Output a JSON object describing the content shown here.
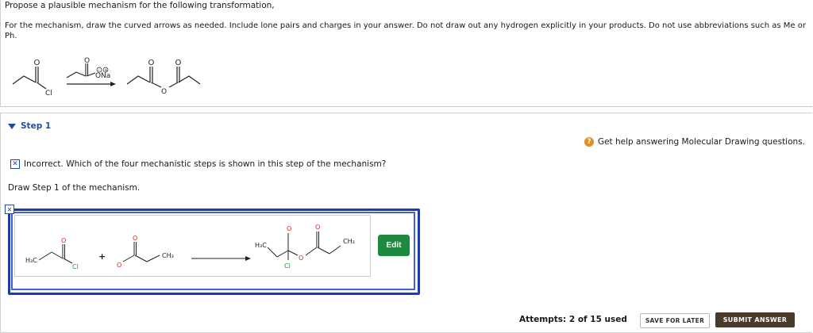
{
  "question": {
    "title": "Propose a plausible mechanism for the following transformation,",
    "instructions": "For the mechanism, draw the curved arrows as needed. Include lone pairs and charges in your answer.  Do not draw out any hydrogen explicitly in your products. Do not use abbreviations such as Me or Ph.",
    "reaction": {
      "reactant_atoms": [
        "O",
        "Cl"
      ],
      "reagent_atoms": [
        "O",
        "O",
        "Na"
      ],
      "reagent_charges": [
        "-",
        "+"
      ],
      "product_atoms": [
        "O",
        "O",
        "O"
      ]
    }
  },
  "step": {
    "label": "Step 1",
    "help_text": "Get help answering Molecular Drawing questions.",
    "help_icon": "question-mark-icon",
    "feedback_icon": "x-mark-icon",
    "feedback_text": "Incorrect. Which of the four mechanistic steps is shown in this step of the mechanism?",
    "draw_label": "Draw Step 1 of the mechanism.",
    "drawing": {
      "left_atoms": {
        "h3c": "H₃C",
        "o_top": "O",
        "cl": "Cl"
      },
      "plus": "+",
      "anion_atoms": {
        "o_top": "O",
        "o_minus": "O",
        "ch3": "CH₃"
      },
      "product_atoms": {
        "o_minus": "O",
        "o_top": "O",
        "h3c": "H₃C",
        "ch3": "CH₃",
        "o_mid": "O",
        "cl": "Cl"
      }
    },
    "edit_label": "Edit"
  },
  "footer": {
    "attempts": "Attempts: 2 of 15 used",
    "save_label": "SAVE FOR LATER",
    "submit_label": "SUBMIT ANSWER"
  },
  "colors": {
    "accent_blue": "#1f4e9c",
    "canvas_border": "#1d3bb0",
    "edit_green": "#1f8a3f",
    "submit_brown": "#4a3a2c",
    "oxygen_red": "#d12a1f",
    "chlorine_green": "#1a9a36",
    "help_orange": "#e0902a"
  }
}
